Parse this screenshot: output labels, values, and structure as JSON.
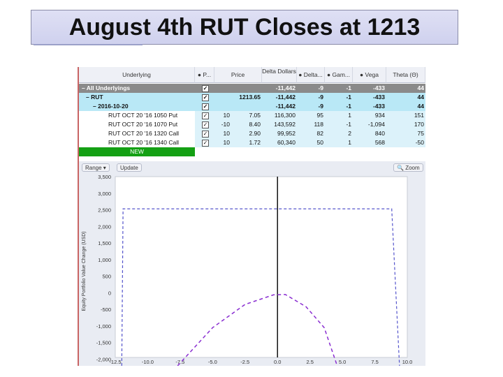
{
  "slide": {
    "title": "August 4th RUT Closes at 1213"
  },
  "grid": {
    "headers": [
      {
        "label": "Underlying"
      },
      {
        "label": "● P..."
      },
      {
        "label": "Price"
      },
      {
        "label": "Delta Dollars"
      },
      {
        "label": "● Delta..."
      },
      {
        "label": "● Gam..."
      },
      {
        "label": "● Vega"
      },
      {
        "label": "Theta (Θ)"
      }
    ],
    "rows": [
      {
        "name": "– All Underlyings",
        "pos": "",
        "price": "",
        "delta_dollars": "-11,442",
        "delta": "-9",
        "gamma": "-1",
        "vega": "-433",
        "theta": "44",
        "checked": true,
        "style": "all"
      },
      {
        "name": "– RUT",
        "pos": "",
        "price": "1213.65",
        "delta_dollars": "-11,442",
        "delta": "-9",
        "gamma": "-1",
        "vega": "-433",
        "theta": "44",
        "checked": true,
        "style": "rut"
      },
      {
        "name": "– 2016-10-20",
        "pos": "",
        "price": "",
        "delta_dollars": "-11,442",
        "delta": "-9",
        "gamma": "-1",
        "vega": "-433",
        "theta": "44",
        "checked": true,
        "style": "exp"
      },
      {
        "name": "RUT OCT 20 '16 1050 Put",
        "pos": "10",
        "price": "7.05",
        "delta_dollars": "116,300",
        "delta": "95",
        "gamma": "1",
        "vega": "934",
        "theta": "151",
        "checked": true,
        "style": "leg"
      },
      {
        "name": "RUT OCT 20 '16 1070 Put",
        "pos": "-10",
        "price": "8.40",
        "delta_dollars": "143,592",
        "delta": "118",
        "gamma": "-1",
        "vega": "-1,094",
        "theta": "170",
        "checked": true,
        "style": "leg"
      },
      {
        "name": "RUT OCT 20 '16 1320 Call",
        "pos": "10",
        "price": "2.90",
        "delta_dollars": "99,952",
        "delta": "82",
        "gamma": "2",
        "vega": "840",
        "theta": "75",
        "checked": true,
        "style": "leg"
      },
      {
        "name": "RUT OCT 20 '16 1340 Call",
        "pos": "10",
        "price": "1.72",
        "delta_dollars": "60,340",
        "delta": "50",
        "gamma": "1",
        "vega": "568",
        "theta": "-50",
        "checked": true,
        "style": "leg"
      }
    ],
    "new_label": "NEW"
  },
  "toolbar": {
    "range_label": "Range ▾",
    "update_label": "Update",
    "zoom_label": "Zoom"
  },
  "colors": {
    "new_green": "#14a014",
    "header_gray": "#8a8a8a",
    "rut_bg": "#b9e8f6",
    "leg_bg": "#dcf2fa",
    "series": "#5454cc",
    "series2": "#8a2ed1"
  },
  "chart_data": {
    "type": "line",
    "ylabel": "Equity Portfolio Value Change (USD)",
    "xlim": [
      -12.5,
      10.0
    ],
    "ylim": [
      -2200,
      3500
    ],
    "x_ticks": [
      "-12.5",
      "-10.0",
      "-7.5",
      "-5.0",
      "-2.5",
      "0.0",
      "2.5",
      "5.0",
      "7.5",
      "10.0"
    ],
    "x_tick_values": [
      -12.5,
      -10.0,
      -7.5,
      -5.0,
      -2.5,
      0.0,
      2.5,
      5.0,
      7.5,
      10.0
    ],
    "y_ticks": [
      "3,500",
      "3,000",
      "2,500",
      "2,000",
      "1,500",
      "1,000",
      "500",
      "0",
      "-500",
      "-1,000",
      "-1,500",
      "-2,000"
    ],
    "y_tick_values": [
      3500,
      3000,
      2500,
      2000,
      1500,
      1000,
      500,
      0,
      -500,
      -1000,
      -1500,
      -2000
    ],
    "current_x": 0.0,
    "series": [
      {
        "style": "dashed",
        "x": [
          -12.0,
          -11.9,
          8.8,
          9.4
        ],
        "y": [
          -2200,
          2530,
          2530,
          -2200
        ]
      },
      {
        "style": "dashed",
        "x": [
          -7.7,
          -5.0,
          -2.5,
          -0.3,
          0.6,
          2.2,
          3.6,
          4.6
        ],
        "y": [
          -2200,
          -1050,
          -350,
          -60,
          -50,
          -420,
          -1050,
          -2200
        ]
      }
    ]
  }
}
